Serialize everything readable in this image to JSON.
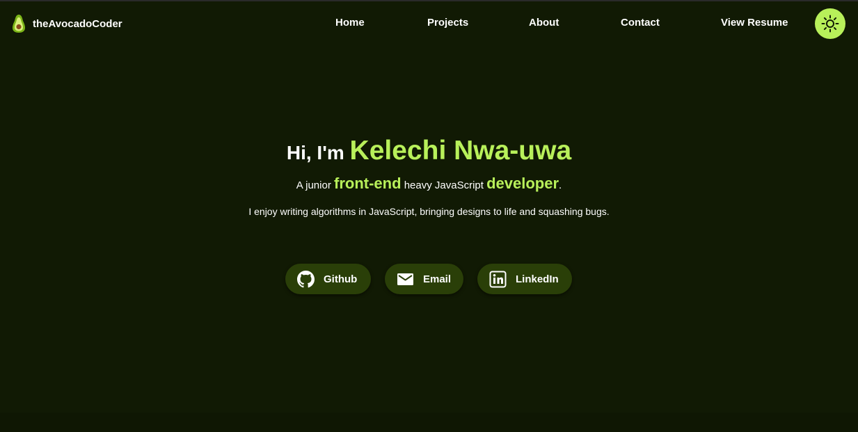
{
  "brand": {
    "name": "theAvocadoCoder",
    "logo_icon": "avocado-icon"
  },
  "nav": {
    "home": "Home",
    "projects": "Projects",
    "about": "About",
    "contact": "Contact",
    "resume": "View Resume",
    "theme_toggle_icon": "sun-icon"
  },
  "hero": {
    "greeting": "Hi, I'm",
    "name": "Kelechi Nwa-uwa",
    "sub_part1": "A junior",
    "sub_highlight1": "front-end",
    "sub_part2": "heavy JavaScript",
    "sub_highlight2": "developer",
    "sub_end": ".",
    "description": "I enjoy writing algorithms in JavaScript, bringing designs to life and squashing bugs."
  },
  "socials": [
    {
      "label": "Github",
      "icon": "github-icon"
    },
    {
      "label": "Email",
      "icon": "mail-icon"
    },
    {
      "label": "LinkedIn",
      "icon": "linkedin-icon"
    }
  ],
  "colors": {
    "background": "#111a04",
    "accent": "#b8f05a",
    "button_bg": "#2a3f08",
    "text": "#ffffff"
  }
}
